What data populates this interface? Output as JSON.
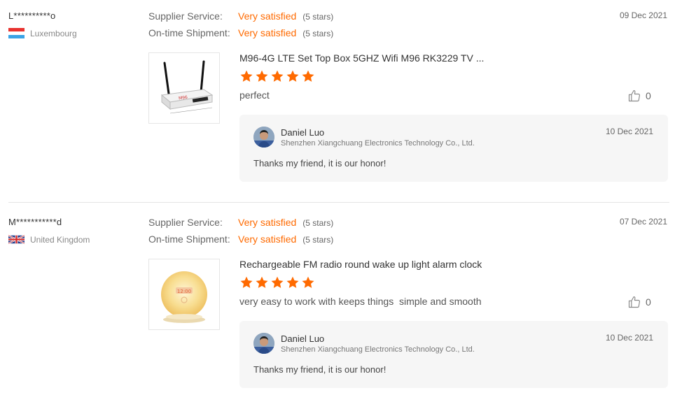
{
  "reviews": [
    {
      "buyer": "L**********o",
      "country": "Luxembourg",
      "flag_icon": "luxembourg-flag-icon",
      "supplier_service_label": "Supplier Service:",
      "supplier_service_value": "Very satisfied",
      "supplier_service_stars": "(5 stars)",
      "shipment_label": "On-time Shipment:",
      "shipment_value": "Very satisfied",
      "shipment_stars": "(5 stars)",
      "date": "09 Dec 2021",
      "product_title": "M96-4G LTE Set Top Box 5GHZ Wifi M96 RK3229 TV ...",
      "product_image_icon": "tv-box-image",
      "rating": 5,
      "comment": "perfect",
      "likes": "0",
      "reply": {
        "name": "Daniel Luo",
        "company": "Shenzhen Xiangchuang Electronics Technology Co., Ltd.",
        "date": "10 Dec 2021",
        "text": "Thanks my friend, it is our honor!"
      }
    },
    {
      "buyer": "M***********d",
      "country": "United Kingdom",
      "flag_icon": "uk-flag-icon",
      "supplier_service_label": "Supplier Service:",
      "supplier_service_value": "Very satisfied",
      "supplier_service_stars": "(5 stars)",
      "shipment_label": "On-time Shipment:",
      "shipment_value": "Very satisfied",
      "shipment_stars": "(5 stars)",
      "date": "07 Dec 2021",
      "product_title": "Rechargeable FM radio round wake up light alarm clock",
      "product_image_icon": "wake-up-light-image",
      "rating": 5,
      "comment": "very easy to work with keeps things  simple and smooth",
      "likes": "0",
      "reply": {
        "name": "Daniel Luo",
        "company": "Shenzhen Xiangchuang Electronics Technology Co., Ltd.",
        "date": "10 Dec 2021",
        "text": "Thanks my friend, it is our honor!"
      }
    }
  ],
  "colors": {
    "accent": "#ff6a00",
    "star": "#ff6a00",
    "reply_bg": "#f6f6f6",
    "divider": "#e4e4e4"
  }
}
